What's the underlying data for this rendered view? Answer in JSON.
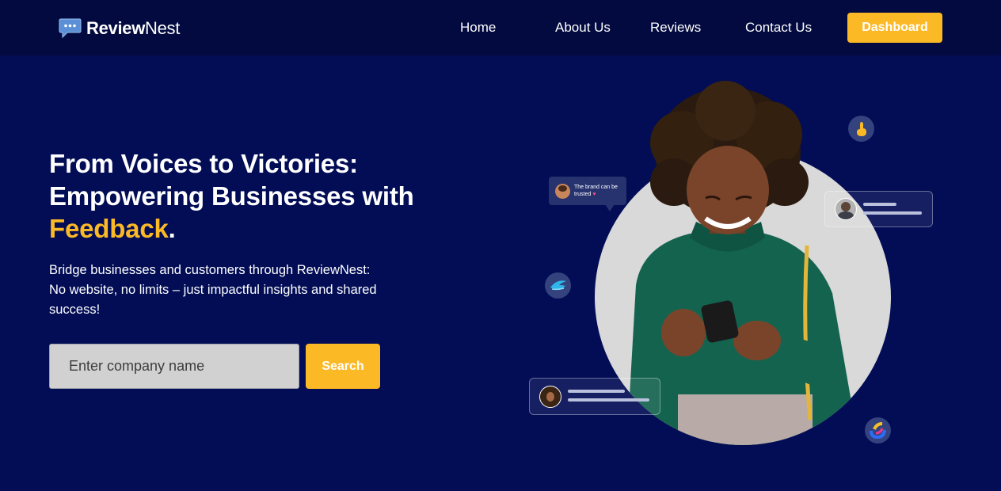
{
  "brand": {
    "name_bold": "Review",
    "name_light": "Nest",
    "logo_icon": "chat-bubble-icon"
  },
  "nav": {
    "links": [
      "Home",
      "About Us",
      "Reviews",
      "Contact Us"
    ],
    "cta_label": "Dashboard"
  },
  "hero": {
    "headline_line1": "From Voices to Victories:",
    "headline_line2": "Empowering Businesses with",
    "headline_highlight": "Feedback",
    "headline_end": ".",
    "subtitle": "Bridge businesses and customers through ReviewNest: No website, no limits – just impactful insights and shared success!",
    "search_placeholder": "Enter company name",
    "search_button": "Search"
  },
  "illustration": {
    "bubble_text": "The brand can be trusted"
  },
  "colors": {
    "background": "#020d55",
    "nav_background": "#030a3f",
    "accent": "#fbb926"
  }
}
